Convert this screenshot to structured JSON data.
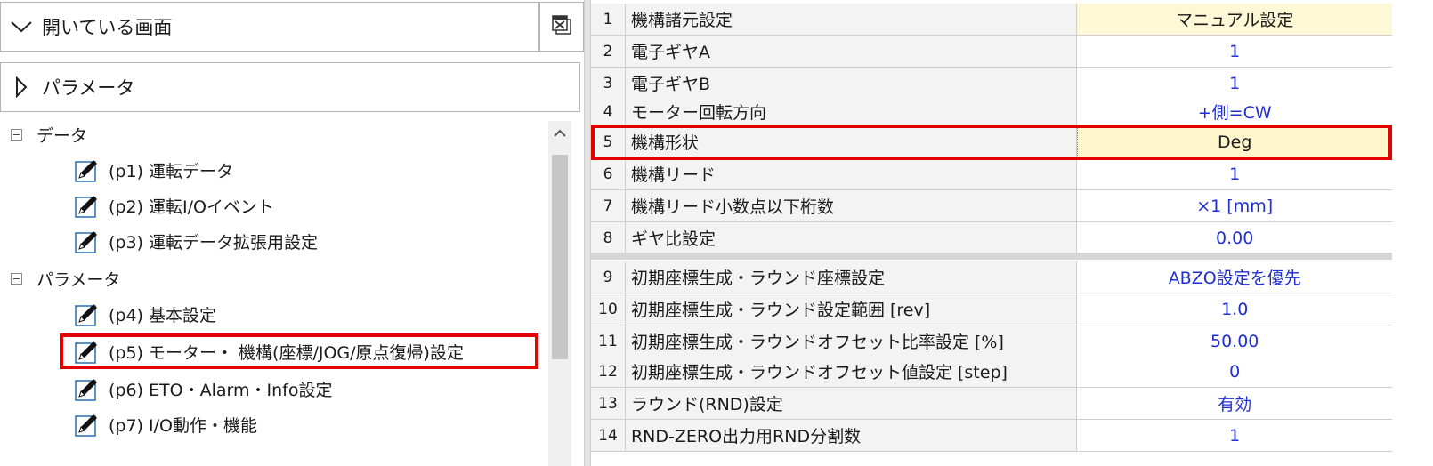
{
  "left_panel": {
    "open_screens_label": "開いている画面",
    "parameter_header_label": "パラメータ",
    "tree": {
      "groups": [
        {
          "label": "データ",
          "items": [
            "(p1) 運転データ",
            "(p2) 運転I/Oイベント",
            "(p3) 運転データ拡張用設定"
          ]
        },
        {
          "label": "パラメータ",
          "items": [
            "(p4) 基本設定",
            "(p5) モーター・ 機構(座標/JOG/原点復帰)設定",
            "(p6) ETO・Alarm・Info設定",
            "(p7) I/O動作・機能"
          ]
        }
      ],
      "selected_item": "(p5) モーター・ 機構(座標/JOG/原点復帰)設定"
    },
    "icons": {
      "collapse": "triangle-down-icon",
      "expand": "triangle-right-icon",
      "close_all": "close-all-windows-icon",
      "edit": "pencil-edit-icon",
      "scroll_up": "chevron-up-icon"
    }
  },
  "table": {
    "rows": [
      {
        "no": "1",
        "name": "機構諸元設定",
        "value": "マニュアル設定"
      },
      {
        "no": "2",
        "name": "電子ギヤA",
        "value": "1"
      },
      {
        "no": "3",
        "name": "電子ギヤB",
        "value": "1"
      },
      {
        "no": "4",
        "name": "モーター回転方向",
        "value": "+側=CW"
      },
      {
        "no": "5",
        "name": "機構形状",
        "value": "Deg"
      },
      {
        "no": "6",
        "name": "機構リード",
        "value": "1"
      },
      {
        "no": "7",
        "name": "機構リード小数点以下桁数",
        "value": "×1 [mm]"
      },
      {
        "no": "8",
        "name": "ギヤ比設定",
        "value": "0.00"
      },
      {
        "no": "9",
        "name": "初期座標生成・ラウンド座標設定",
        "value": "ABZO設定を優先"
      },
      {
        "no": "10",
        "name": "初期座標生成・ラウンド設定範囲 [rev]",
        "value": "1.0"
      },
      {
        "no": "11",
        "name": "初期座標生成・ラウンドオフセット比率設定 [%]",
        "value": "50.00"
      },
      {
        "no": "12",
        "name": "初期座標生成・ラウンドオフセット値設定 [step]",
        "value": "0"
      },
      {
        "no": "13",
        "name": "ラウンド(RND)設定",
        "value": "有効"
      },
      {
        "no": "14",
        "name": "RND-ZERO出力用RND分割数",
        "value": "1"
      }
    ],
    "selected_row": "5"
  },
  "colors": {
    "highlight_red": "#e40000",
    "value_blue": "#1f2fd0",
    "selected_cell": "#fff6cc",
    "label_bg": "#f3f3f3"
  }
}
